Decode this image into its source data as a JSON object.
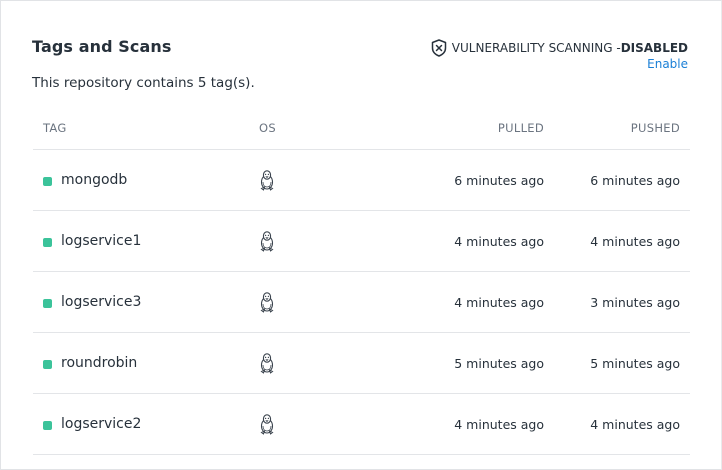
{
  "header": {
    "title": "Tags and Scans",
    "subtitle": "This repository contains 5 tag(s)."
  },
  "scanning": {
    "icon": "shield-x-icon",
    "label": "VULNERABILITY SCANNING - ",
    "status": "DISABLED",
    "enable_link": "Enable",
    "link_color": "#1a7fd6"
  },
  "table": {
    "columns": {
      "tag": "TAG",
      "os": "OS",
      "pulled": "PULLED",
      "pushed": "PUSHED"
    },
    "rows": [
      {
        "tag": "mongodb",
        "os_icon": "linux-tux-icon",
        "pulled": "6 minutes ago",
        "pushed": "6 minutes ago"
      },
      {
        "tag": "logservice1",
        "os_icon": "linux-tux-icon",
        "pulled": "4 minutes ago",
        "pushed": "4 minutes ago"
      },
      {
        "tag": "logservice3",
        "os_icon": "linux-tux-icon",
        "pulled": "4 minutes ago",
        "pushed": "3 minutes ago"
      },
      {
        "tag": "roundrobin",
        "os_icon": "linux-tux-icon",
        "pulled": "5 minutes ago",
        "pushed": "5 minutes ago"
      },
      {
        "tag": "logservice2",
        "os_icon": "linux-tux-icon",
        "pulled": "4 minutes ago",
        "pushed": "4 minutes ago"
      }
    ],
    "status_dot_color": "#3bc39a"
  }
}
